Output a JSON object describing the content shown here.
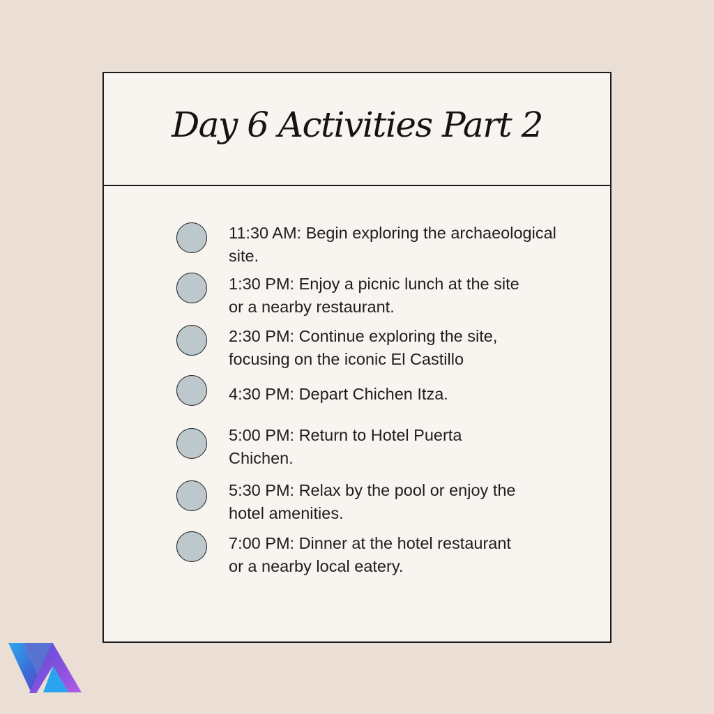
{
  "card": {
    "title": "Day 6 Activities Part 2"
  },
  "activities": [
    {
      "text": "11:30 AM: Begin exploring the archaeological\nsite."
    },
    {
      "text": "1:30 PM: Enjoy a picnic lunch at the site\nor a nearby restaurant."
    },
    {
      "text": "2:30 PM: Continue exploring the site,\nfocusing on the iconic El Castillo"
    },
    {
      "text": "4:30 PM: Depart Chichen Itza."
    },
    {
      "text": "5:00 PM: Return to Hotel Puerta\nChichen."
    },
    {
      "text": "5:30 PM: Relax by the pool or enjoy the\nhotel amenities."
    },
    {
      "text": "7:00 PM: Dinner at the hotel restaurant\nor a nearby local eatery."
    }
  ],
  "colors": {
    "background": "#eaded5",
    "card": "#f8f4ef",
    "bullet": "#bdc8cc",
    "border": "#1c1c1c"
  },
  "logo": {
    "icon": "va-logo-icon"
  }
}
